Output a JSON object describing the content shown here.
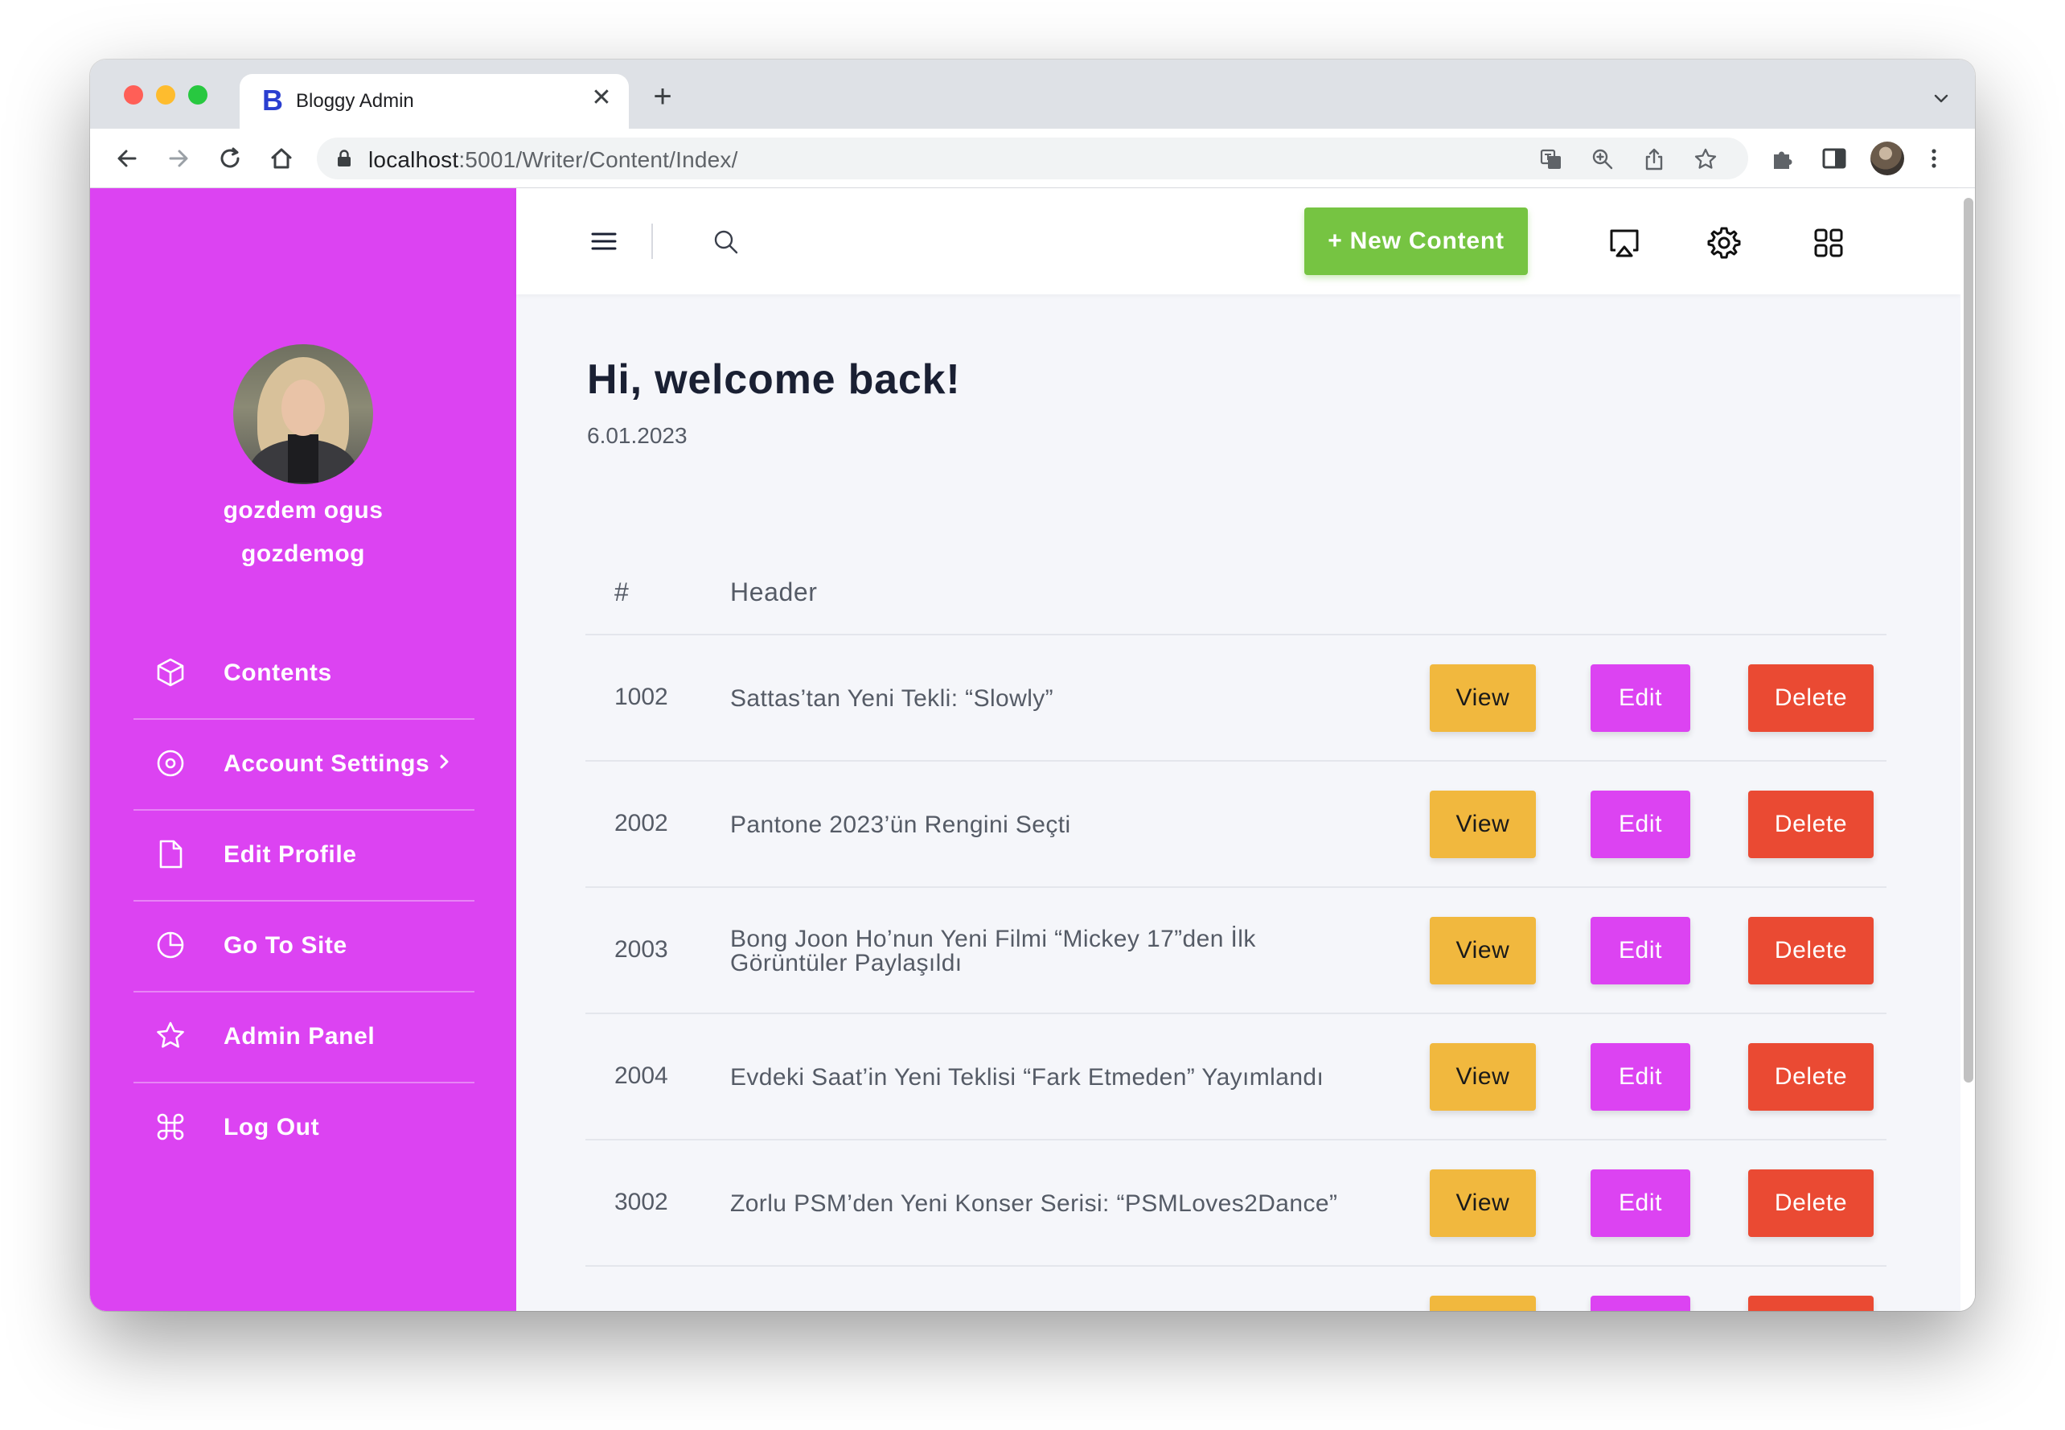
{
  "browser": {
    "tab_title": "Bloggy Admin",
    "tab_favicon_letter": "B",
    "tab_close_glyph": "✕",
    "new_tab_glyph": "+",
    "url_host": "localhost",
    "url_path": ":5001/Writer/Content/Index/"
  },
  "sidebar": {
    "user_name": "gozdem ogus",
    "user_handle": "gozdemog",
    "items": [
      {
        "label": "Contents",
        "icon": "box-icon"
      },
      {
        "label": "Account Settings",
        "icon": "target-icon"
      },
      {
        "label": "Edit Profile",
        "icon": "file-icon"
      },
      {
        "label": "Go To Site",
        "icon": "pie-chart-icon"
      },
      {
        "label": "Admin Panel",
        "icon": "star-icon"
      },
      {
        "label": "Log Out",
        "icon": "command-icon"
      }
    ]
  },
  "topbar": {
    "new_content_label": "+ New Content"
  },
  "main": {
    "greeting": "Hi, welcome back!",
    "date": "6.01.2023"
  },
  "table": {
    "columns": [
      "#",
      "Header"
    ],
    "view_label": "View",
    "edit_label": "Edit",
    "delete_label": "Delete",
    "rows": [
      {
        "id": "1002",
        "header": "Sattas’tan Yeni Tekli: “Slowly”"
      },
      {
        "id": "2002",
        "header": "Pantone 2023’ün Rengini Seçti"
      },
      {
        "id": "2003",
        "header": "Bong Joon Ho’nun Yeni Filmi “Mickey 17”den İlk Görüntüler Paylaşıldı"
      },
      {
        "id": "2004",
        "header": "Evdeki Saat’in Yeni Teklisi “Fark Etmeden” Yayımlandı"
      },
      {
        "id": "3002",
        "header": "Zorlu PSM’den Yeni Konser Serisi: “PSMLoves2Dance”"
      }
    ]
  },
  "colors": {
    "sidebar": "#dc43f2",
    "new_button": "#76c442",
    "view": "#f1b83e",
    "edit": "#dc43f2",
    "delete": "#ea4a33"
  }
}
